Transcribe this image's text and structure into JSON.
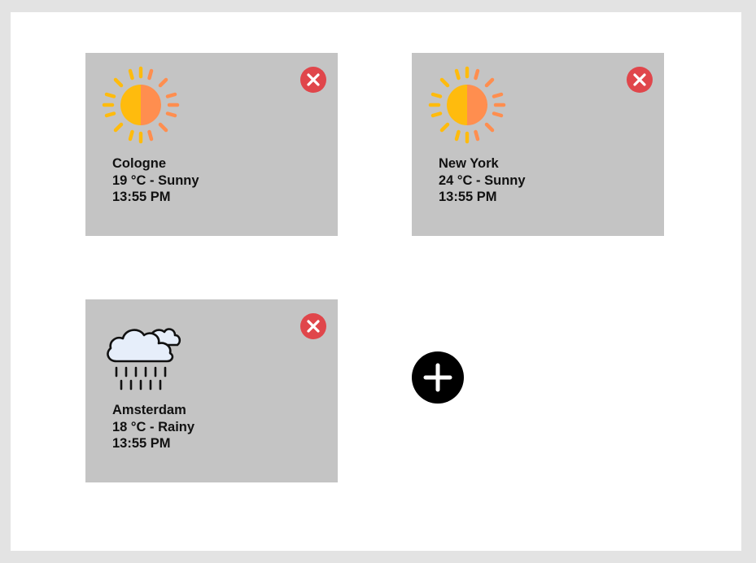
{
  "colors": {
    "page_background": "#e3e3e3",
    "canvas_background": "#ffffff",
    "card_background": "#c4c4c4",
    "close_button": "#e0464b",
    "add_button": "#000000",
    "sun_left": "#ffbb0d",
    "sun_right": "#ff8e4f"
  },
  "cards": [
    {
      "city": "Cologne",
      "temp_condition": "19 °C - Sunny",
      "time": "13:55 PM",
      "icon": "sun-icon"
    },
    {
      "city": "New York",
      "temp_condition": "24 °C - Sunny",
      "time": "13:55 PM",
      "icon": "sun-icon"
    },
    {
      "city": "Amsterdam",
      "temp_condition": "18 °C - Rainy",
      "time": "13:55 PM",
      "icon": "rain-cloud-icon"
    }
  ],
  "add_button": {
    "icon": "plus-icon"
  },
  "close_button": {
    "icon": "close-icon"
  }
}
